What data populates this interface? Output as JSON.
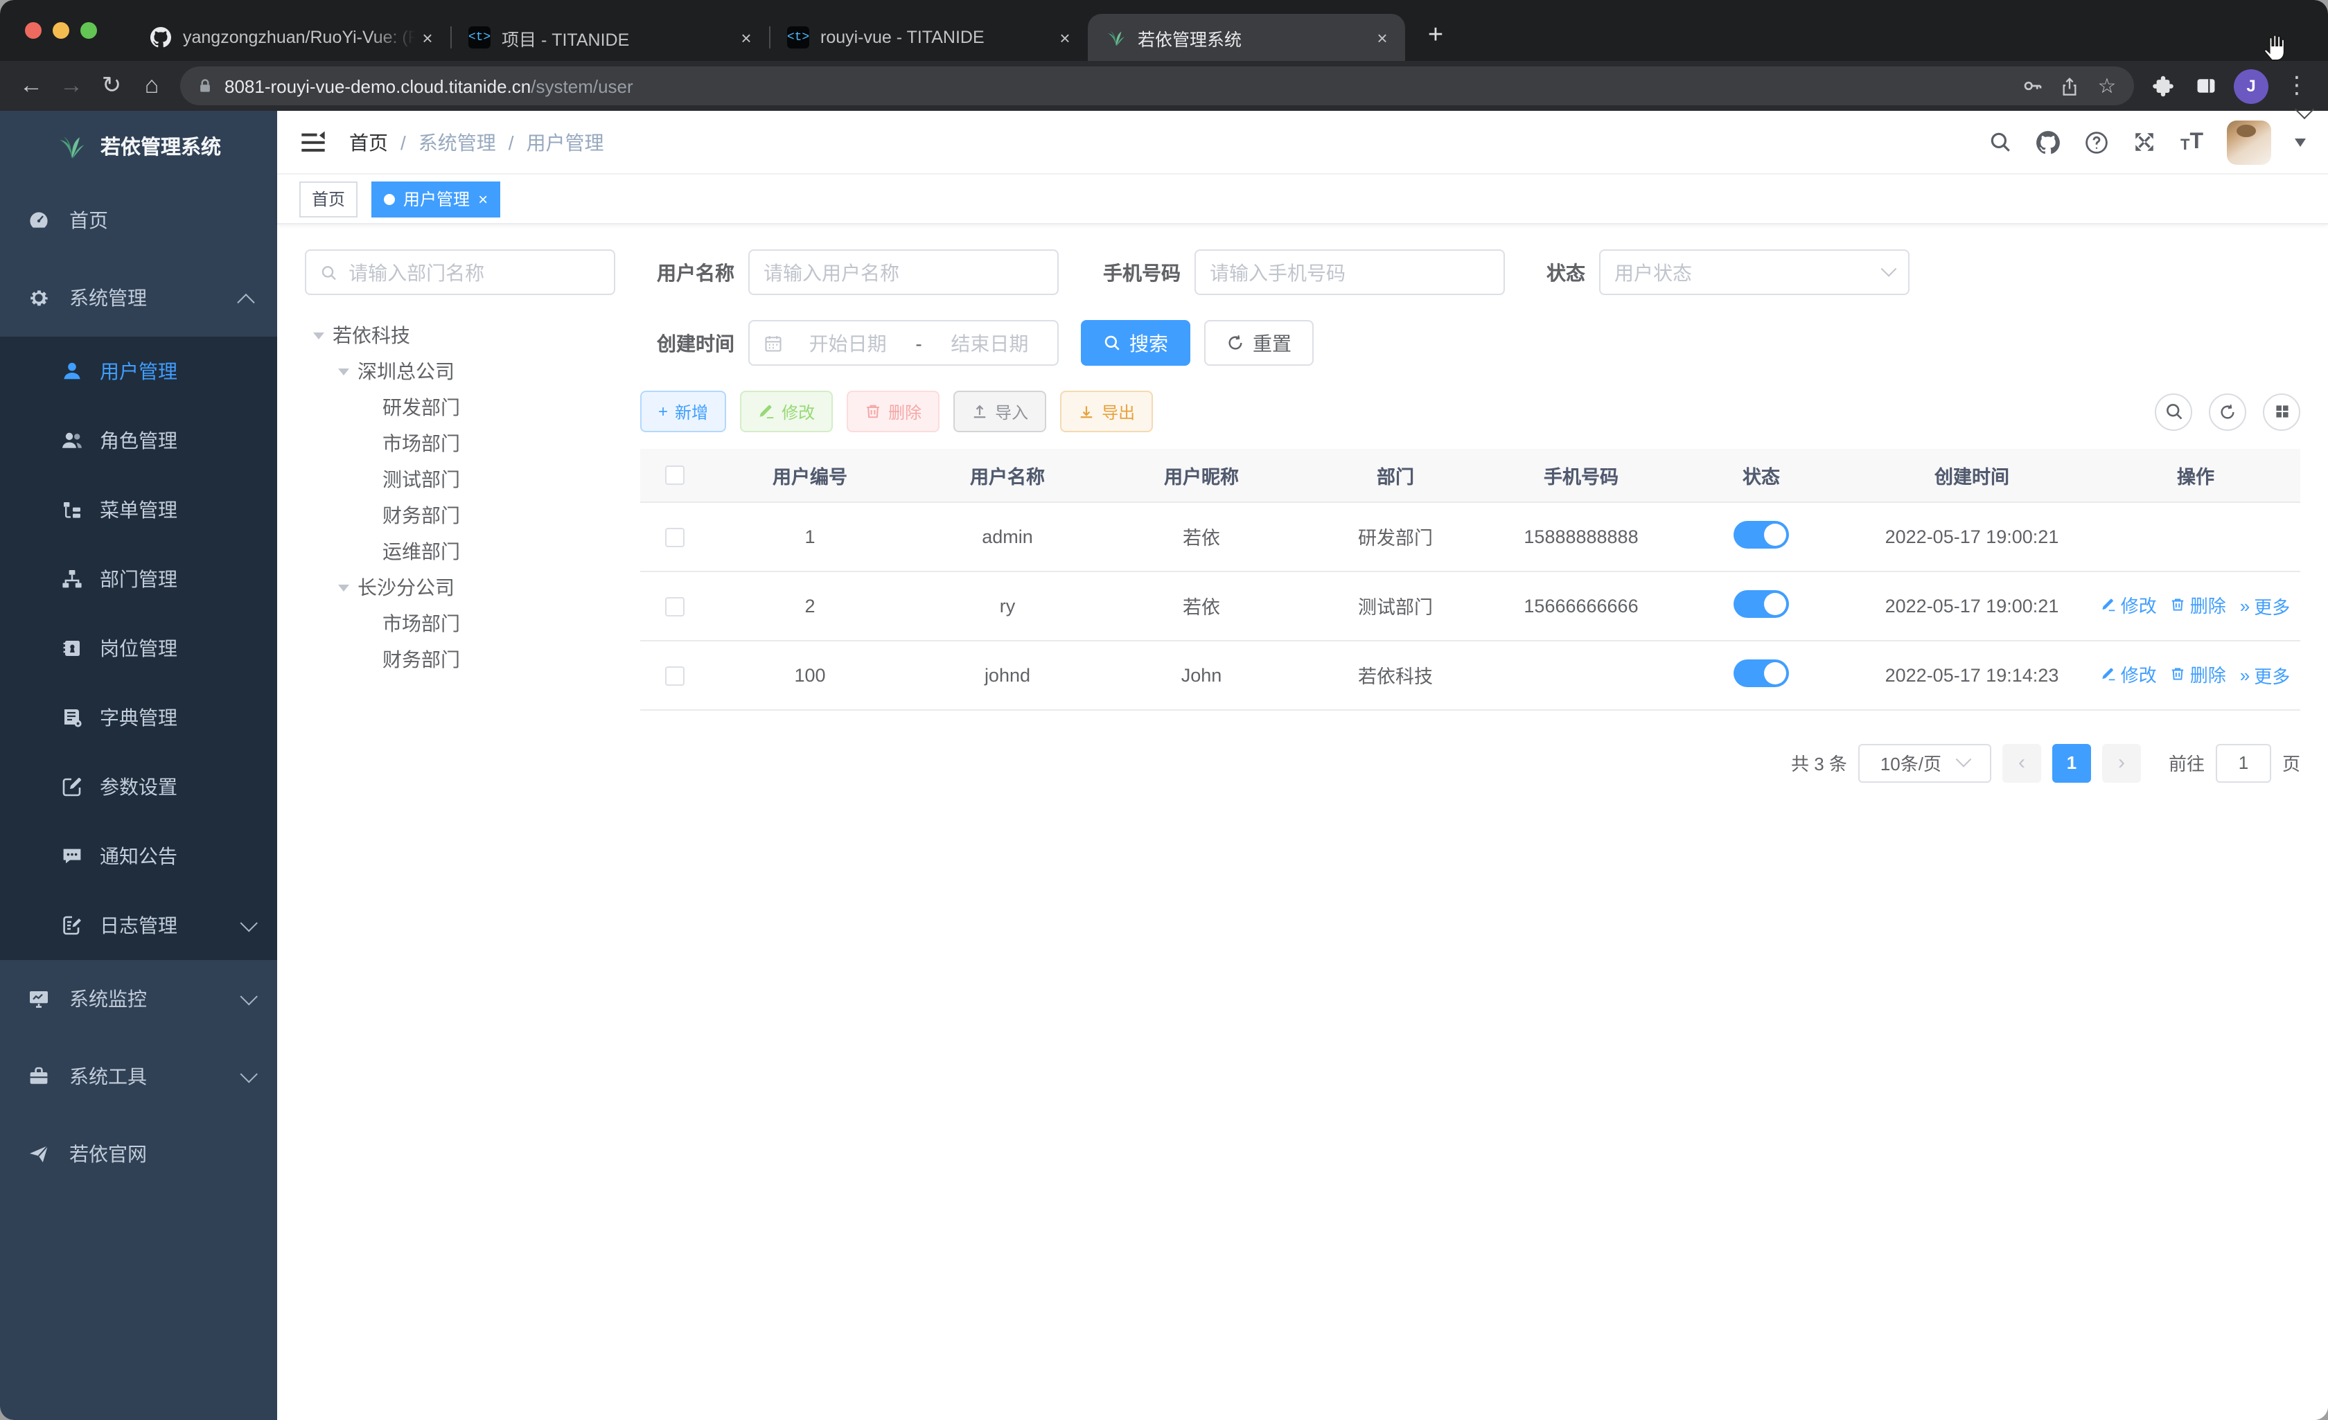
{
  "browser": {
    "tabs": [
      {
        "title": "yangzongzhuan/RuoYi-Vue: (Ru",
        "icon": "github-favicon"
      },
      {
        "title": "项目 - TITANIDE",
        "icon": "titanide-favicon"
      },
      {
        "title": "rouyi-vue - TITANIDE",
        "icon": "titanide-favicon"
      },
      {
        "title": "若依管理系统",
        "icon": "ruoyi-favicon"
      }
    ],
    "titanide_glyph": "<t>",
    "url": {
      "host": "8081-rouyi-vue-demo.cloud.titanide.cn",
      "path": "/system/user"
    },
    "profile_initial": "J"
  },
  "icons": {
    "back": "←",
    "forward": "→",
    "reload": "↻",
    "home": "⌂",
    "star": "☆",
    "overflow_menu": "⋮",
    "new_tab": "+",
    "close": "×",
    "font_small": "T",
    "font_large": "T",
    "plus": "+",
    "prev_page": "‹",
    "next_page": "›",
    "more_arrows": "»"
  },
  "sidebar": {
    "logo_title": "若依管理系统",
    "items": [
      {
        "label": "首页"
      },
      {
        "label": "系统管理"
      },
      {
        "label": "用户管理"
      },
      {
        "label": "角色管理"
      },
      {
        "label": "菜单管理"
      },
      {
        "label": "部门管理"
      },
      {
        "label": "岗位管理"
      },
      {
        "label": "字典管理"
      },
      {
        "label": "参数设置"
      },
      {
        "label": "通知公告"
      },
      {
        "label": "日志管理"
      },
      {
        "label": "系统监控"
      },
      {
        "label": "系统工具"
      },
      {
        "label": "若依官网"
      }
    ]
  },
  "header": {
    "breadcrumb": [
      "首页",
      "系统管理",
      "用户管理"
    ],
    "separator": "/"
  },
  "tags": [
    {
      "label": "首页"
    },
    {
      "label": "用户管理"
    }
  ],
  "filters": {
    "dept_search_placeholder": "请输入部门名称",
    "username_label": "用户名称",
    "username_placeholder": "请输入用户名称",
    "phone_label": "手机号码",
    "phone_placeholder": "请输入手机号码",
    "status_label": "状态",
    "status_placeholder": "用户状态",
    "created_label": "创建时间",
    "date_start_placeholder": "开始日期",
    "date_separator": "-",
    "date_end_placeholder": "结束日期",
    "search_button": "搜索",
    "reset_button": "重置"
  },
  "dept_tree": [
    {
      "label": "若依科技"
    },
    {
      "label": "深圳总公司"
    },
    {
      "label": "研发部门"
    },
    {
      "label": "市场部门"
    },
    {
      "label": "测试部门"
    },
    {
      "label": "财务部门"
    },
    {
      "label": "运维部门"
    },
    {
      "label": "长沙分公司"
    },
    {
      "label": "市场部门"
    },
    {
      "label": "财务部门"
    }
  ],
  "toolbar": {
    "add": "新增",
    "edit": "修改",
    "delete": "删除",
    "import": "导入",
    "export": "导出"
  },
  "table": {
    "columns": [
      "用户编号",
      "用户名称",
      "用户昵称",
      "部门",
      "手机号码",
      "状态",
      "创建时间",
      "操作"
    ],
    "rows": [
      {
        "id": "1",
        "username": "admin",
        "nickname": "若依",
        "dept": "研发部门",
        "phone": "15888888888",
        "created": "2022-05-17 19:00:21"
      },
      {
        "id": "2",
        "username": "ry",
        "nickname": "若依",
        "dept": "测试部门",
        "phone": "15666666666",
        "created": "2022-05-17 19:00:21"
      },
      {
        "id": "100",
        "username": "johnd",
        "nickname": "John",
        "dept": "若依科技",
        "phone": "",
        "created": "2022-05-17 19:14:23"
      }
    ],
    "row_actions": {
      "edit": "修改",
      "delete": "删除",
      "more": "更多"
    }
  },
  "pagination": {
    "total": "共 3 条",
    "page_size": "10条/页",
    "page": "1",
    "goto_label": "前往",
    "goto_value": "1",
    "page_unit": "页"
  },
  "colors": {
    "accent": "#409eff",
    "sidebar_bg": "#304156",
    "submenu_bg": "#1f2d3d",
    "toggle_on": "#409eff"
  }
}
